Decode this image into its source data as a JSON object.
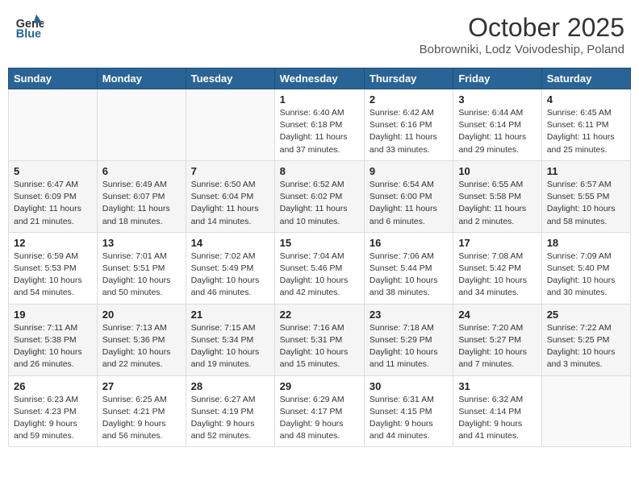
{
  "header": {
    "logo_general": "General",
    "logo_blue": "Blue",
    "month": "October 2025",
    "location": "Bobrowniki, Lodz Voivodeship, Poland"
  },
  "weekdays": [
    "Sunday",
    "Monday",
    "Tuesday",
    "Wednesday",
    "Thursday",
    "Friday",
    "Saturday"
  ],
  "weeks": [
    [
      {
        "day": "",
        "info": ""
      },
      {
        "day": "",
        "info": ""
      },
      {
        "day": "",
        "info": ""
      },
      {
        "day": "1",
        "info": "Sunrise: 6:40 AM\nSunset: 6:18 PM\nDaylight: 11 hours\nand 37 minutes."
      },
      {
        "day": "2",
        "info": "Sunrise: 6:42 AM\nSunset: 6:16 PM\nDaylight: 11 hours\nand 33 minutes."
      },
      {
        "day": "3",
        "info": "Sunrise: 6:44 AM\nSunset: 6:14 PM\nDaylight: 11 hours\nand 29 minutes."
      },
      {
        "day": "4",
        "info": "Sunrise: 6:45 AM\nSunset: 6:11 PM\nDaylight: 11 hours\nand 25 minutes."
      }
    ],
    [
      {
        "day": "5",
        "info": "Sunrise: 6:47 AM\nSunset: 6:09 PM\nDaylight: 11 hours\nand 21 minutes."
      },
      {
        "day": "6",
        "info": "Sunrise: 6:49 AM\nSunset: 6:07 PM\nDaylight: 11 hours\nand 18 minutes."
      },
      {
        "day": "7",
        "info": "Sunrise: 6:50 AM\nSunset: 6:04 PM\nDaylight: 11 hours\nand 14 minutes."
      },
      {
        "day": "8",
        "info": "Sunrise: 6:52 AM\nSunset: 6:02 PM\nDaylight: 11 hours\nand 10 minutes."
      },
      {
        "day": "9",
        "info": "Sunrise: 6:54 AM\nSunset: 6:00 PM\nDaylight: 11 hours\nand 6 minutes."
      },
      {
        "day": "10",
        "info": "Sunrise: 6:55 AM\nSunset: 5:58 PM\nDaylight: 11 hours\nand 2 minutes."
      },
      {
        "day": "11",
        "info": "Sunrise: 6:57 AM\nSunset: 5:55 PM\nDaylight: 10 hours\nand 58 minutes."
      }
    ],
    [
      {
        "day": "12",
        "info": "Sunrise: 6:59 AM\nSunset: 5:53 PM\nDaylight: 10 hours\nand 54 minutes."
      },
      {
        "day": "13",
        "info": "Sunrise: 7:01 AM\nSunset: 5:51 PM\nDaylight: 10 hours\nand 50 minutes."
      },
      {
        "day": "14",
        "info": "Sunrise: 7:02 AM\nSunset: 5:49 PM\nDaylight: 10 hours\nand 46 minutes."
      },
      {
        "day": "15",
        "info": "Sunrise: 7:04 AM\nSunset: 5:46 PM\nDaylight: 10 hours\nand 42 minutes."
      },
      {
        "day": "16",
        "info": "Sunrise: 7:06 AM\nSunset: 5:44 PM\nDaylight: 10 hours\nand 38 minutes."
      },
      {
        "day": "17",
        "info": "Sunrise: 7:08 AM\nSunset: 5:42 PM\nDaylight: 10 hours\nand 34 minutes."
      },
      {
        "day": "18",
        "info": "Sunrise: 7:09 AM\nSunset: 5:40 PM\nDaylight: 10 hours\nand 30 minutes."
      }
    ],
    [
      {
        "day": "19",
        "info": "Sunrise: 7:11 AM\nSunset: 5:38 PM\nDaylight: 10 hours\nand 26 minutes."
      },
      {
        "day": "20",
        "info": "Sunrise: 7:13 AM\nSunset: 5:36 PM\nDaylight: 10 hours\nand 22 minutes."
      },
      {
        "day": "21",
        "info": "Sunrise: 7:15 AM\nSunset: 5:34 PM\nDaylight: 10 hours\nand 19 minutes."
      },
      {
        "day": "22",
        "info": "Sunrise: 7:16 AM\nSunset: 5:31 PM\nDaylight: 10 hours\nand 15 minutes."
      },
      {
        "day": "23",
        "info": "Sunrise: 7:18 AM\nSunset: 5:29 PM\nDaylight: 10 hours\nand 11 minutes."
      },
      {
        "day": "24",
        "info": "Sunrise: 7:20 AM\nSunset: 5:27 PM\nDaylight: 10 hours\nand 7 minutes."
      },
      {
        "day": "25",
        "info": "Sunrise: 7:22 AM\nSunset: 5:25 PM\nDaylight: 10 hours\nand 3 minutes."
      }
    ],
    [
      {
        "day": "26",
        "info": "Sunrise: 6:23 AM\nSunset: 4:23 PM\nDaylight: 9 hours\nand 59 minutes."
      },
      {
        "day": "27",
        "info": "Sunrise: 6:25 AM\nSunset: 4:21 PM\nDaylight: 9 hours\nand 56 minutes."
      },
      {
        "day": "28",
        "info": "Sunrise: 6:27 AM\nSunset: 4:19 PM\nDaylight: 9 hours\nand 52 minutes."
      },
      {
        "day": "29",
        "info": "Sunrise: 6:29 AM\nSunset: 4:17 PM\nDaylight: 9 hours\nand 48 minutes."
      },
      {
        "day": "30",
        "info": "Sunrise: 6:31 AM\nSunset: 4:15 PM\nDaylight: 9 hours\nand 44 minutes."
      },
      {
        "day": "31",
        "info": "Sunrise: 6:32 AM\nSunset: 4:14 PM\nDaylight: 9 hours\nand 41 minutes."
      },
      {
        "day": "",
        "info": ""
      }
    ]
  ]
}
